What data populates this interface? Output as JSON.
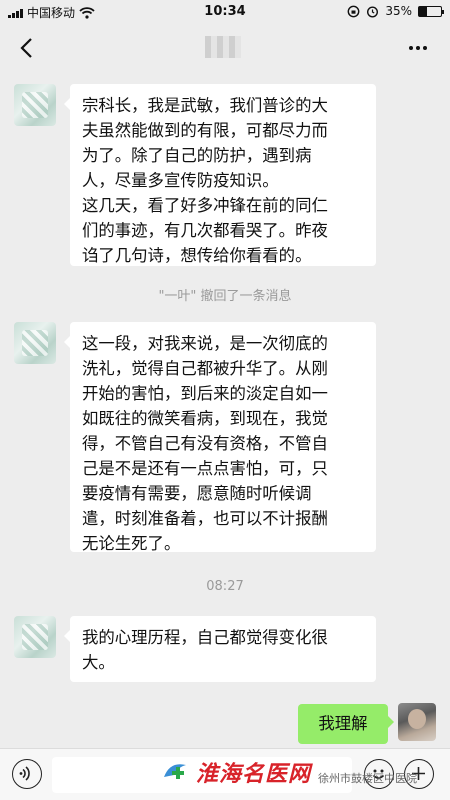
{
  "status_bar": {
    "carrier": "中国移动",
    "time": "10:34",
    "battery_percent": "35%",
    "battery_level": 0.35
  },
  "nav": {
    "back_icon": "chevron-left-icon",
    "more_icon": "more-dots-icon"
  },
  "messages": [
    {
      "side": "left",
      "lines": [
        "宗科长，我是武敏，我们普诊的大",
        "夫虽然能做到的有限，可都尽力而",
        "为了。除了自己的防护，遇到病",
        "人，尽量多宣传防疫知识。",
        "这几天，看了好多冲锋在前的同仁",
        "们的事迹，有几次都看哭了。昨夜",
        "诌了几句诗，想传给你看看的。"
      ]
    },
    {
      "side": "left",
      "lines": [
        "这一段，对我来说，是一次彻底的",
        "洗礼，觉得自己都被升华了。从刚",
        "开始的害怕，到后来的淡定自如一",
        "如既往的微笑看病，到现在，我觉",
        "得，不管自己有没有资格，不管自",
        "己是不是还有一点点害怕，可，只",
        "要疫情有需要，愿意随时听候调",
        "遣，时刻准备着，也可以不计报酬",
        "无论生死了。"
      ]
    },
    {
      "side": "left",
      "lines": [
        "我的心理历程，自己都觉得变化很",
        "大。"
      ]
    },
    {
      "side": "right",
      "text": "我理解"
    }
  ],
  "system_notes": {
    "recall": "\"一叶\" 撤回了一条消息",
    "timestamp": "08:27"
  },
  "watermark": {
    "logo_text": "淮海名医网",
    "caption": "徐州市鼓楼区中医院"
  },
  "colors": {
    "background": "#ededed",
    "left_bubble": "#ffffff",
    "right_bubble": "#95ec69",
    "watermark_red": "#d8232a"
  }
}
